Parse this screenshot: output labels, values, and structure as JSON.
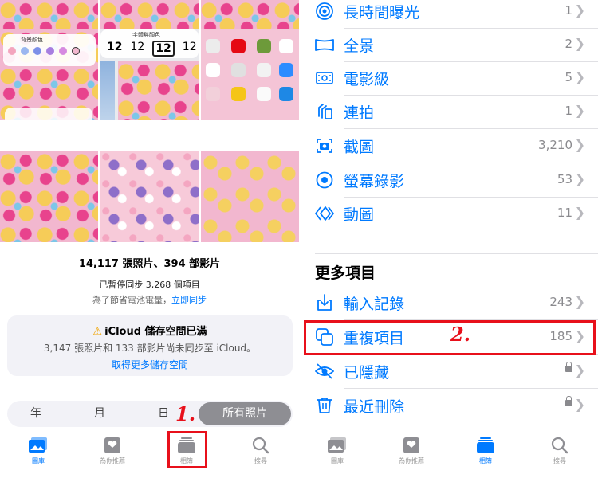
{
  "left": {
    "summary": {
      "counts": "14,117 張照片、394 部影片",
      "sync_paused": "已暫停同步 3,268 個項目",
      "sync_reason": "為了節省電池電量，",
      "sync_now": "立即同步"
    },
    "icloud_alert": {
      "title": "iCloud 儲存空間已滿",
      "description": "3,147 張照片和 133 部影片尚未同步至 iCloud。",
      "action": "取得更多儲存空間"
    },
    "thumbs": {
      "bg_color_title": "背景顏色",
      "clock_title": "字體與顏色",
      "clock_digits": [
        "12",
        "12",
        "12",
        "12"
      ]
    },
    "segments": [
      "年",
      "月",
      "日",
      "所有照片"
    ],
    "tabs": [
      "圖庫",
      "為你推薦",
      "相簿",
      "搜尋"
    ],
    "annotation_1": "1."
  },
  "right": {
    "media_types": [
      {
        "label": "長時間曝光",
        "count": "1",
        "icon": "long-exposure-icon"
      },
      {
        "label": "全景",
        "count": "2",
        "icon": "panorama-icon"
      },
      {
        "label": "電影級",
        "count": "5",
        "icon": "cinematic-icon"
      },
      {
        "label": "連拍",
        "count": "1",
        "icon": "burst-icon"
      },
      {
        "label": "截圖",
        "count": "3,210",
        "icon": "screenshot-icon"
      },
      {
        "label": "螢幕錄影",
        "count": "53",
        "icon": "screen-recording-icon"
      },
      {
        "label": "動圖",
        "count": "11",
        "icon": "animated-icon"
      }
    ],
    "more_title": "更多項目",
    "more_items": [
      {
        "label": "輸入記錄",
        "count": "243",
        "icon": "import-icon"
      },
      {
        "label": "重複項目",
        "count": "185",
        "icon": "duplicates-icon"
      },
      {
        "label": "已隱藏",
        "count": "",
        "icon": "hidden-icon",
        "locked": true
      },
      {
        "label": "最近刪除",
        "count": "",
        "icon": "trash-icon",
        "locked": true
      }
    ],
    "tabs": [
      "圖庫",
      "為你推薦",
      "相簿",
      "搜尋"
    ],
    "annotation_2": "2."
  },
  "colors": {
    "accent": "#007aff",
    "annotation_red": "#e8101b",
    "tab_inactive": "#999999"
  }
}
